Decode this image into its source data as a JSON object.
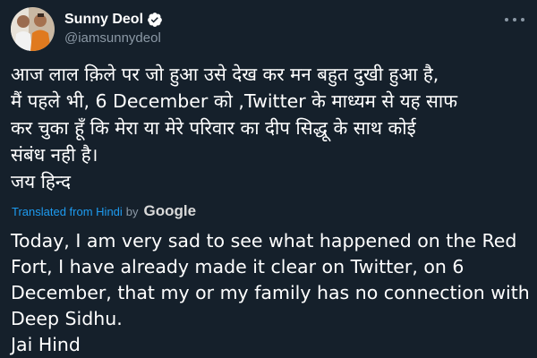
{
  "user": {
    "display_name": "Sunny Deol",
    "handle": "@iamsunnydeol",
    "verified": true,
    "avatar_icon": "avatar-photo"
  },
  "tweet": {
    "original_text": "आज लाल क़िले पर जो हुआ उसे देख कर मन बहुत दुखी हुआ है,\nमैं पहले भी, 6 December को ,Twitter के माध्यम से यह साफ\nकर चुका हूँ कि मेरा या मेरे परिवार का दीप सिद्धू के साथ कोई\nसंबंध नही है।\nजय हिन्द",
    "translation_label": "Translated from Hindi",
    "translation_by": "by",
    "translation_provider": "Google",
    "translated_text": "Today, I am very sad to see what happened on the Red\nFort, I have already made it clear on Twitter, on 6\nDecember, that my or my family has no connection with\nDeep Sidhu.\n Jai Hind"
  },
  "colors": {
    "background": "#15202b",
    "text_primary": "#ffffff",
    "text_secondary": "#8b98a5",
    "accent": "#1d9bf0"
  },
  "icons": {
    "verified": "verified-badge-icon",
    "more": "more-options-icon"
  }
}
